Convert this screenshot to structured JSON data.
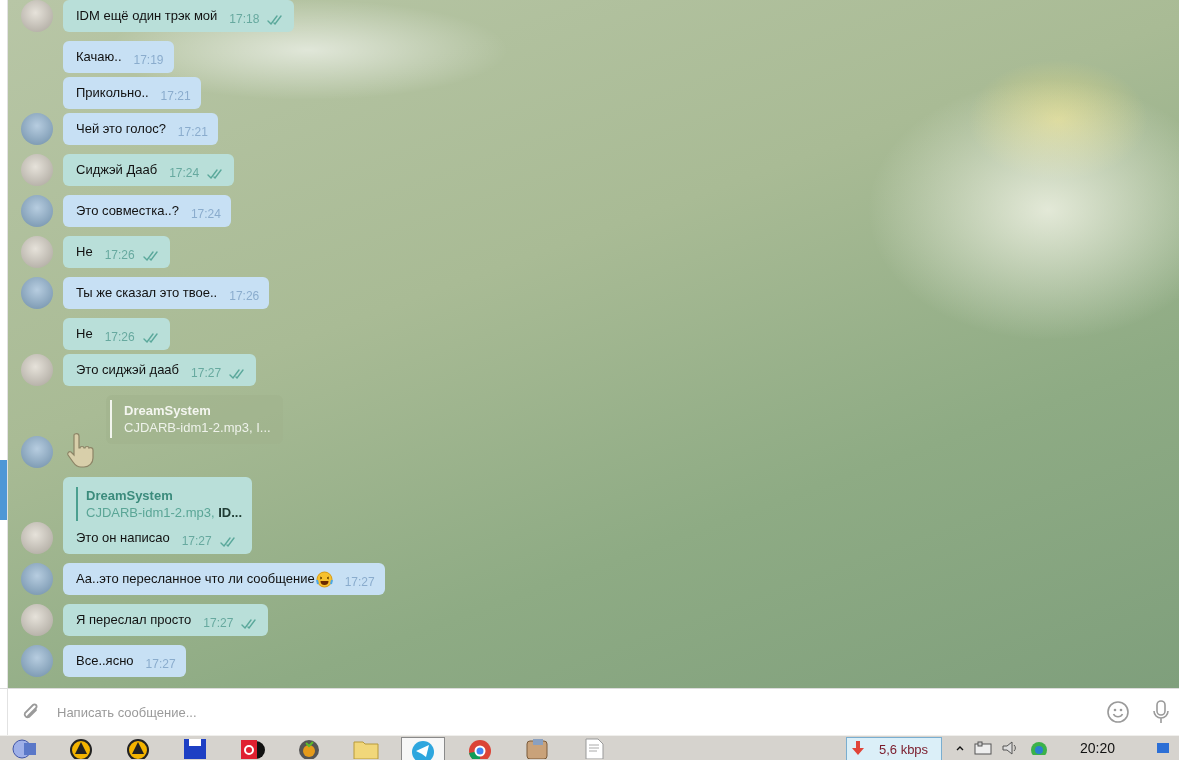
{
  "messages": [
    {
      "kind": "text",
      "outgoing": true,
      "text": "IDM ещё один трэк мой",
      "time": "17:18"
    },
    {
      "kind": "text",
      "outgoing": false,
      "text": "Качаю..",
      "time": "17:19"
    },
    {
      "kind": "text",
      "outgoing": false,
      "text": "Прикольно..",
      "time": "17:21"
    },
    {
      "kind": "text",
      "outgoing": false,
      "text": "Чей это голос?",
      "time": "17:21"
    },
    {
      "kind": "text",
      "outgoing": true,
      "text": "Сиджэй Дааб",
      "time": "17:24"
    },
    {
      "kind": "text",
      "outgoing": false,
      "text": "Это совместка..?",
      "time": "17:24"
    },
    {
      "kind": "text",
      "outgoing": true,
      "text": "Не",
      "time": "17:26"
    },
    {
      "kind": "text",
      "outgoing": false,
      "text": "Ты же сказал это твое..",
      "time": "17:26"
    },
    {
      "kind": "text",
      "outgoing": true,
      "text": "Не",
      "time": "17:26"
    },
    {
      "kind": "text",
      "outgoing": true,
      "text": "Это сиджэй дааб",
      "time": "17:27"
    },
    {
      "kind": "sticker",
      "outgoing": false,
      "reply": {
        "name": "DreamSystem",
        "text": "CJDARB-idm1-2.mp3, I..."
      }
    },
    {
      "kind": "text",
      "outgoing": true,
      "reply": {
        "name": "DreamSystem",
        "text": "CJDARB-idm1-2.mp3,",
        "extra": "ID..."
      },
      "text": "Это он написао",
      "time": "17:27"
    },
    {
      "kind": "text",
      "outgoing": false,
      "text": "Аа..это пересланное что ли сообщение",
      "trailing_emoji": true,
      "time": "17:27"
    },
    {
      "kind": "text",
      "outgoing": true,
      "text": "Я переслал просто",
      "time": "17:27"
    },
    {
      "kind": "text",
      "outgoing": false,
      "text": "Все..ясно",
      "time": "17:27"
    }
  ],
  "composer": {
    "placeholder": "Написать сообщение..."
  },
  "taskbar": {
    "apps": [
      {
        "kind": "globe",
        "selected": false
      },
      {
        "kind": "cone",
        "selected": false
      },
      {
        "kind": "cone",
        "selected": false
      },
      {
        "kind": "floppy",
        "selected": false
      },
      {
        "kind": "media",
        "selected": false
      },
      {
        "kind": "fruit",
        "selected": false
      },
      {
        "kind": "folder",
        "selected": false
      },
      {
        "kind": "plane",
        "selected": true
      },
      {
        "kind": "chrome",
        "selected": false
      },
      {
        "kind": "archive",
        "selected": false
      },
      {
        "kind": "document",
        "selected": false
      }
    ],
    "download_rate": "5,6 kbps",
    "clock": "20:20"
  }
}
